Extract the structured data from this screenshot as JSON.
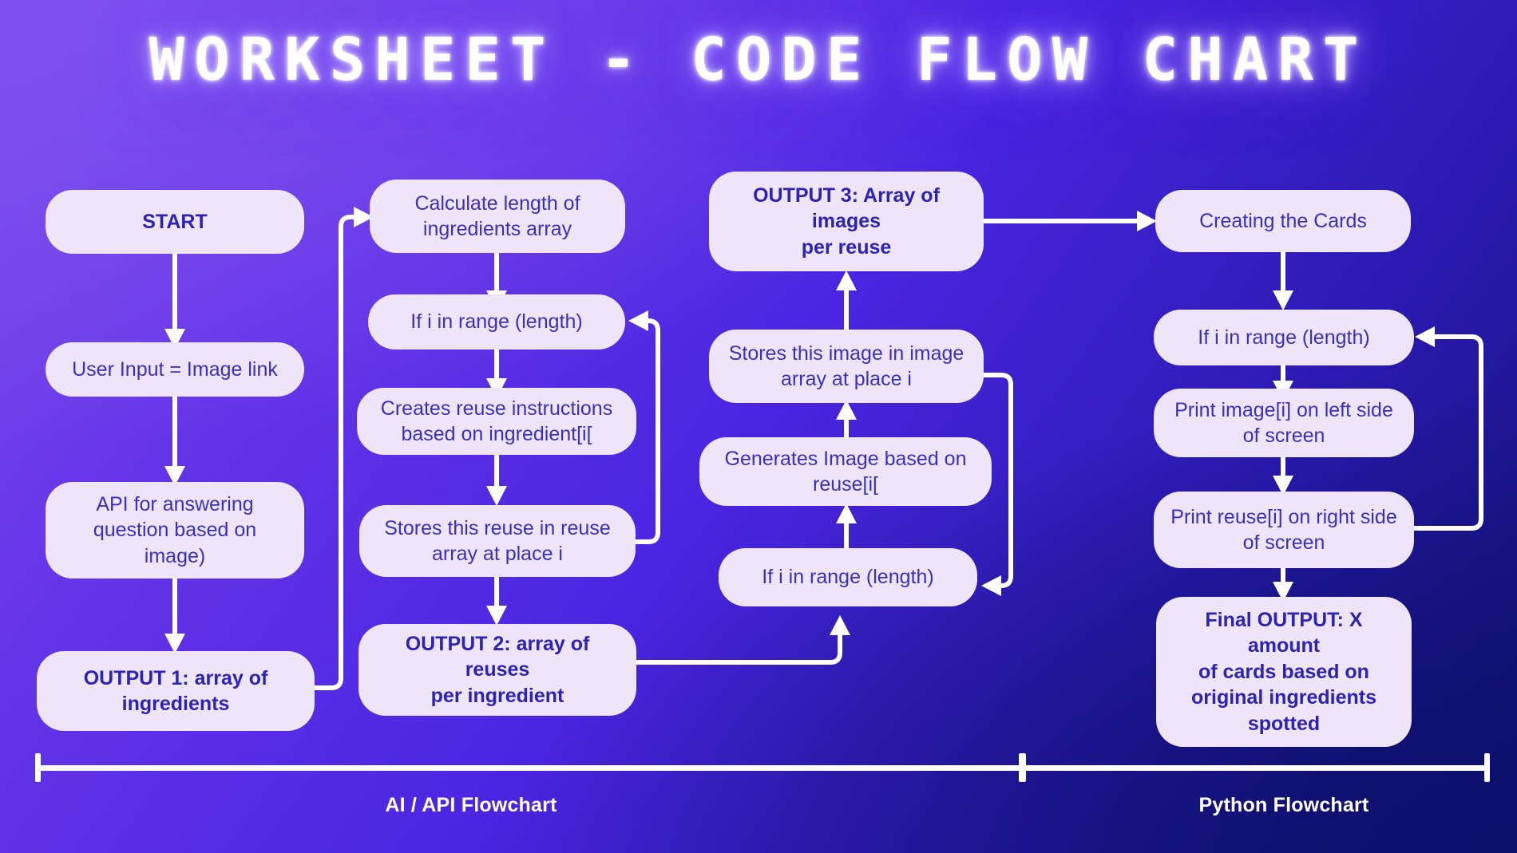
{
  "title": "WORKSHEET  -  CODE FLOW CHART",
  "theme": {
    "bg_top_left": "#7B4DEB",
    "bg_mid": "#4A25E0",
    "bg_bottom_right": "#10116E",
    "node_fill": "#EEE5F8",
    "node_text": "#3B2FBE",
    "node_text_bold": "#2D22B4",
    "connector": "#FFFFFF",
    "title_glow": "#9A7BFF"
  },
  "columns": {
    "col1": {
      "name": "input-column",
      "nodes": [
        {
          "id": "start",
          "label": "START",
          "bold": true
        },
        {
          "id": "user-input",
          "label": "User Input = Image link",
          "bold": false
        },
        {
          "id": "api",
          "label": "API for answering\nquestion based on\nimage)",
          "bold": false
        },
        {
          "id": "output1",
          "label": "OUTPUT 1: array of\ningredients",
          "bold": true
        }
      ]
    },
    "col2": {
      "name": "reuse-loop-column",
      "nodes": [
        {
          "id": "calc-length",
          "label": "Calculate length of\ningredients array",
          "bold": false
        },
        {
          "id": "if-range-2",
          "label": "If i in range (length)",
          "bold": false
        },
        {
          "id": "creates-reuse",
          "label": "Creates reuse instructions\nbased on ingredient[i[",
          "bold": false
        },
        {
          "id": "stores-reuse",
          "label": "Stores this reuse in reuse\narray at place i",
          "bold": false
        },
        {
          "id": "output2",
          "label": "OUTPUT 2: array of reuses\nper ingredient",
          "bold": true
        }
      ]
    },
    "col3": {
      "name": "image-loop-column",
      "nodes": [
        {
          "id": "output3",
          "label": "OUTPUT 3: Array of images\nper reuse",
          "bold": true
        },
        {
          "id": "stores-image",
          "label": "Stores this image in image\narray at place i",
          "bold": false
        },
        {
          "id": "generates-image",
          "label": "Generates Image  based on\nreuse[i[",
          "bold": false
        },
        {
          "id": "if-range-3",
          "label": "If i in range (length)",
          "bold": false
        }
      ]
    },
    "col4": {
      "name": "python-column",
      "nodes": [
        {
          "id": "creating-cards",
          "label": "Creating the Cards",
          "bold": false
        },
        {
          "id": "if-range-4",
          "label": "If i in range (length)",
          "bold": false
        },
        {
          "id": "print-image",
          "label": "Print image[i] on left side\nof screen",
          "bold": false
        },
        {
          "id": "print-reuse",
          "label": "Print reuse[i] on right side\nof screen",
          "bold": false
        },
        {
          "id": "final-output",
          "label": "Final OUTPUT: X amount\nof cards based on\noriginal ingredients\nspotted",
          "bold": true
        }
      ]
    }
  },
  "sections": [
    {
      "id": "ai-api",
      "label": "AI / API Flowchart"
    },
    {
      "id": "python",
      "label": "Python Flowchart"
    }
  ]
}
